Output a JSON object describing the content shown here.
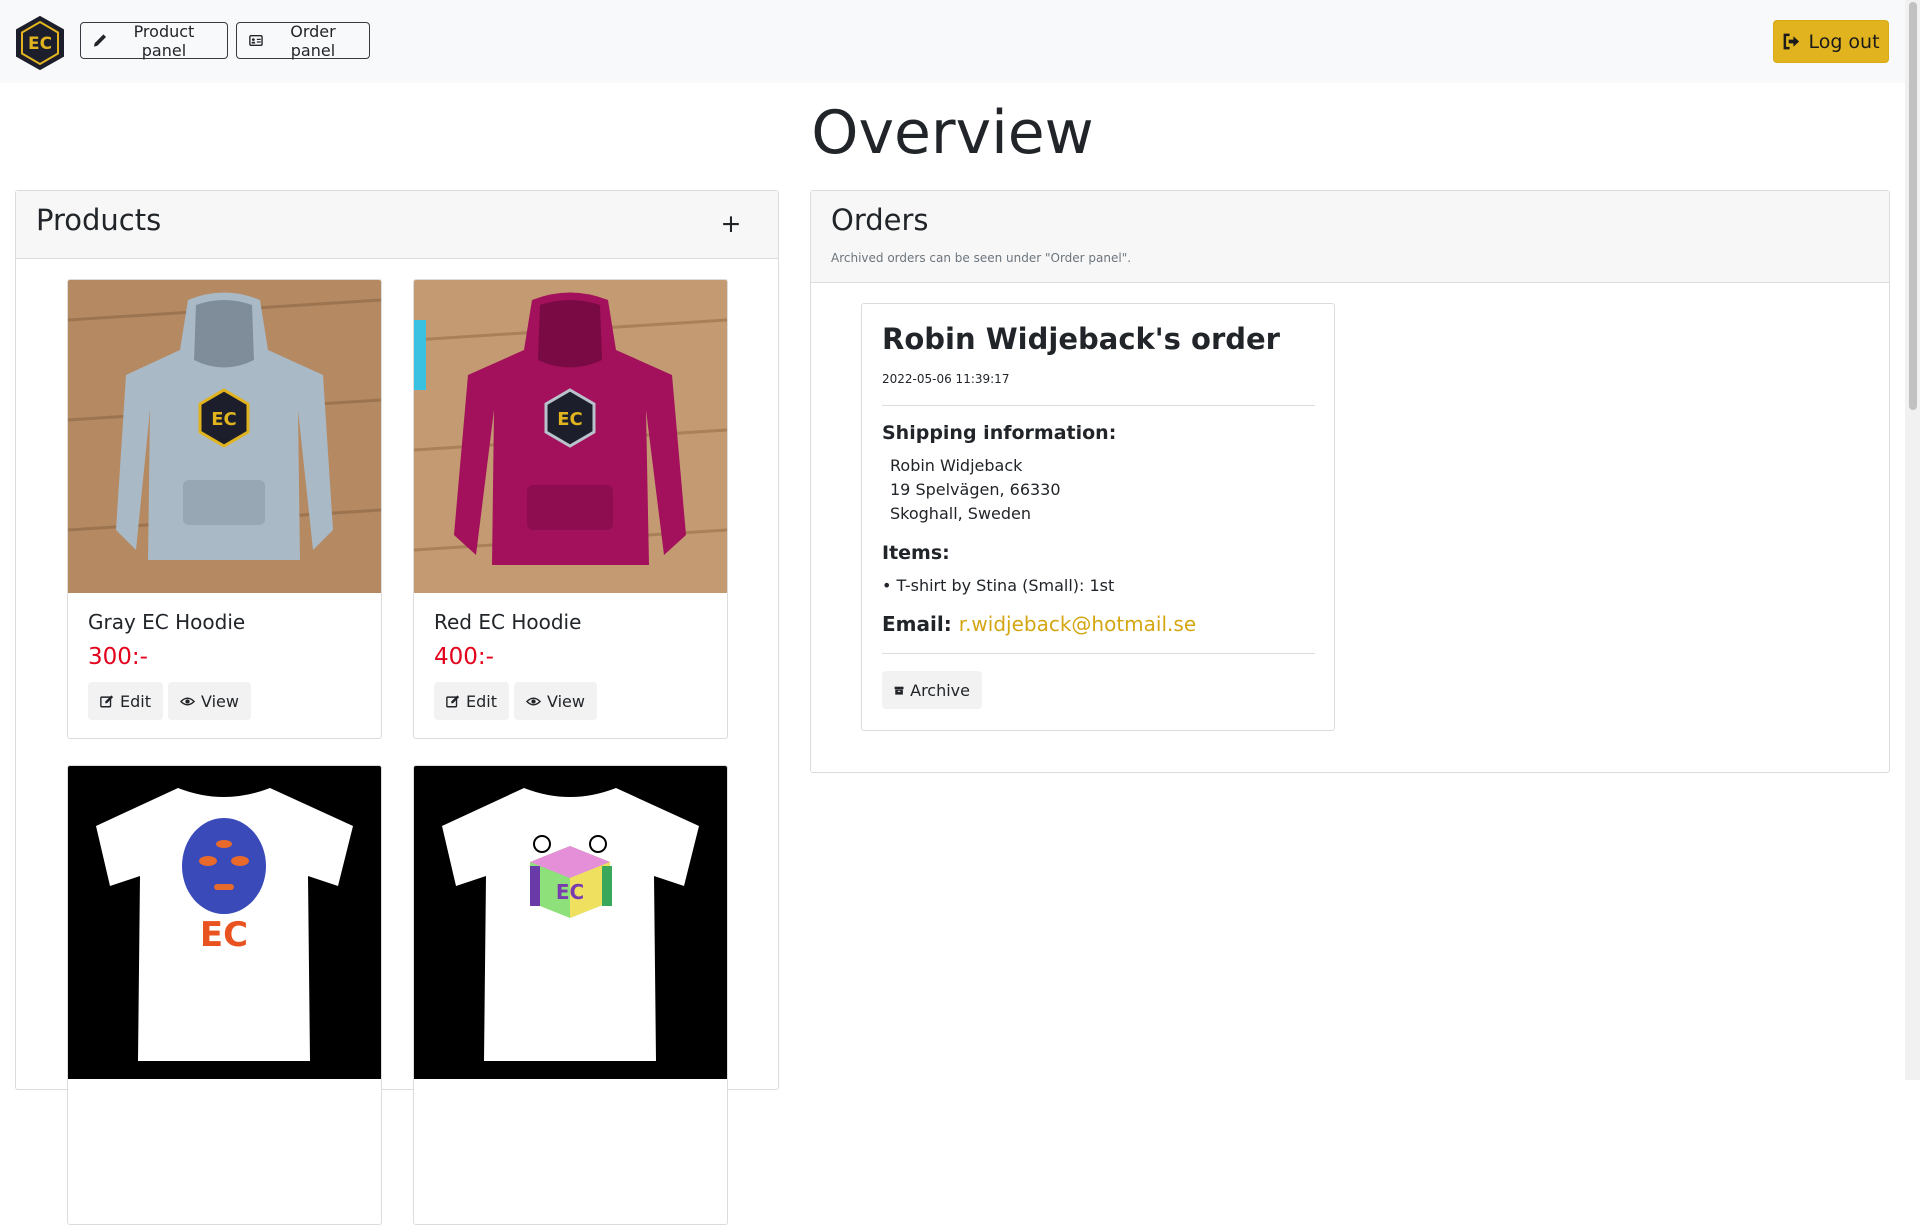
{
  "nav": {
    "logo_icon": "ec-logo-icon",
    "product_panel_label": "Product panel",
    "order_panel_label": "Order panel",
    "logout_label": "Log out"
  },
  "page_title": "Overview",
  "products": {
    "title": "Products",
    "add_label": "+",
    "items": [
      {
        "name": "Gray EC Hoodie",
        "price": "300:-",
        "image": "gray-hoodie-image",
        "edit": "Edit",
        "view": "View"
      },
      {
        "name": "Red EC Hoodie",
        "price": "400:-",
        "image": "red-hoodie-image",
        "edit": "Edit",
        "view": "View"
      },
      {
        "name": "",
        "price": "",
        "image": "blue-face-tshirt-image"
      },
      {
        "name": "",
        "price": "",
        "image": "ec-cube-tshirt-image"
      }
    ]
  },
  "orders": {
    "title": "Orders",
    "note": "Archived orders can be seen under \"Order panel\".",
    "order": {
      "title": "Robin Widjeback's order",
      "date": "2022-05-06 11:39:17",
      "shipping_heading": "Shipping information:",
      "address_line1": "Robin Widjeback",
      "address_line2": "19 Spelvägen, 66330",
      "address_line3": "Skoghall, Sweden",
      "items_heading": "Items:",
      "items": [
        "• T-shirt by Stina (Small): 1st"
      ],
      "email_label": "Email:",
      "email": "r.widjeback@hotmail.se",
      "archive_label": "Archive"
    }
  },
  "colors": {
    "accent": "#e0b31f",
    "price": "#e3001b",
    "link": "#d4a612"
  }
}
